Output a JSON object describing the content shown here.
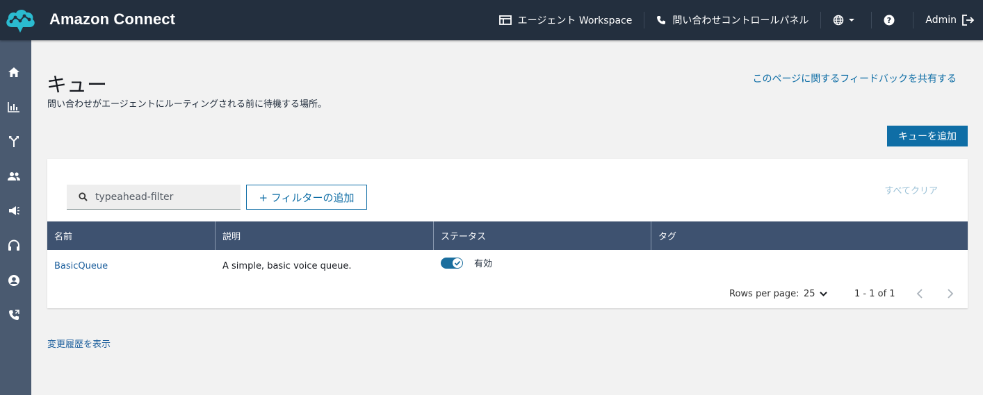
{
  "app": {
    "brand": "Amazon Connect"
  },
  "topnav": {
    "agent_workspace": "エージェント Workspace",
    "ccp": "問い合わせコントロールパネル",
    "user": "Admin"
  },
  "sidebar": {
    "items": [
      {
        "icon": "home-icon"
      },
      {
        "icon": "analytics-icon"
      },
      {
        "icon": "routing-icon"
      },
      {
        "icon": "users-icon"
      },
      {
        "icon": "campaigns-icon"
      },
      {
        "icon": "channels-icon"
      },
      {
        "icon": "customer-profile-icon"
      },
      {
        "icon": "phone-icon"
      }
    ]
  },
  "page": {
    "title": "キュー",
    "description": "問い合わせがエージェントにルーティングされる前に待機する場所。",
    "feedback_link": "このページに関するフィードバックを共有する",
    "add_button": "キューを追加",
    "history_link": "変更履歴を表示"
  },
  "filters": {
    "search_placeholder": "typeahead-filter",
    "add_filter": "+ フィルターの追加",
    "clear_all": "すべてクリア"
  },
  "table": {
    "columns": [
      "名前",
      "説明",
      "ステータス",
      "タグ"
    ],
    "rows": [
      {
        "name": "BasicQueue",
        "description": "A simple, basic voice queue.",
        "status": "有効",
        "enabled": true,
        "tags": ""
      }
    ]
  },
  "pagination": {
    "rows_per_page_label": "Rows per page:",
    "rows_per_page": "25",
    "range": "1 - 1 of 1"
  },
  "colors": {
    "topbar": "#232f3e",
    "sidebar": "#4a5a70",
    "accent": "#0f6ea6",
    "table_header": "#3e5270"
  }
}
